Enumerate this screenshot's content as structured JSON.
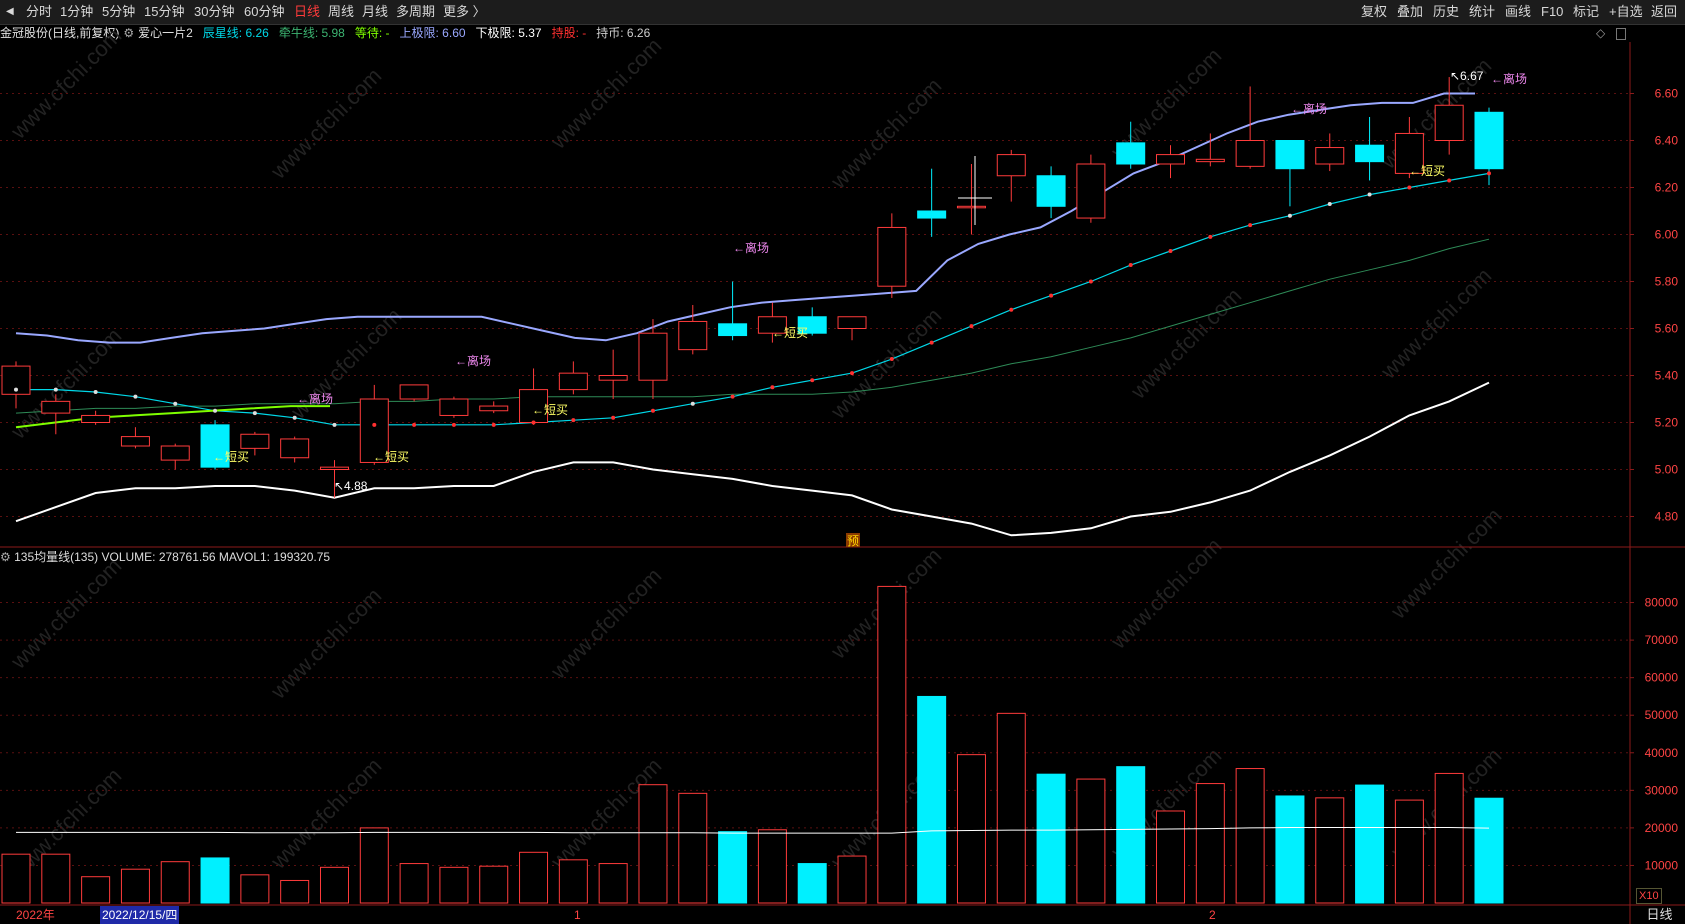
{
  "toolbar": {
    "left_items": [
      "分时",
      "1分钟",
      "5分钟",
      "15分钟",
      "30分钟",
      "60分钟",
      "日线",
      "周线",
      "月线",
      "多周期",
      "更多 〉"
    ],
    "active": "日线",
    "right_items": [
      "复权",
      "叠加",
      "历史",
      "统计",
      "画线",
      "F10",
      "标记",
      "+自选",
      "返回"
    ]
  },
  "title": {
    "stock": "金冠股份(日线,前复权)",
    "indicator": "爱心一片2",
    "items": [
      {
        "label": "辰星线: 6.26",
        "color": "#00d8e8"
      },
      {
        "label": "牵牛线: 5.98",
        "color": "#3cb371"
      },
      {
        "label": "等待: -",
        "color": "#7fff00"
      },
      {
        "label": "上极限: 6.60",
        "color": "#9aa8ff"
      },
      {
        "label": "下极限: 5.37",
        "color": "#ffffff"
      },
      {
        "label": "持股: -",
        "color": "#ff3030"
      },
      {
        "label": "持币: 6.26",
        "color": "#cccccc"
      }
    ]
  },
  "volume_title": "135均量线(135)  VOLUME: 278761.56  MAVOL1: 199320.75",
  "price_axis": [
    "6.60",
    "6.40",
    "6.20",
    "6.00",
    "5.80",
    "5.60",
    "5.40",
    "5.20",
    "5.00",
    "4.80"
  ],
  "volume_axis": [
    "80000",
    "70000",
    "60000",
    "50000",
    "40000",
    "30000",
    "20000",
    "10000"
  ],
  "volume_unit": "X10",
  "right_label": "日线",
  "date_labels": [
    "2022年",
    "2022/12/15/四",
    "1",
    "2"
  ],
  "annotations": {
    "high_label": "6.67",
    "low_label": "4.88",
    "yu": "预",
    "leave": "←离场",
    "buy": "←短买"
  },
  "chart_data": {
    "type": "candlestick",
    "candles": [
      {
        "o": 5.32,
        "c": 5.44,
        "h": 5.46,
        "l": 5.26
      },
      {
        "o": 5.24,
        "c": 5.29,
        "h": 5.32,
        "l": 5.15
      },
      {
        "o": 5.2,
        "c": 5.23,
        "h": 5.25,
        "l": 5.19
      },
      {
        "o": 5.1,
        "c": 5.14,
        "h": 5.18,
        "l": 5.09
      },
      {
        "o": 5.04,
        "c": 5.1,
        "h": 5.11,
        "l": 5.0
      },
      {
        "o": 5.19,
        "c": 5.01,
        "h": 5.21,
        "l": 5.0
      },
      {
        "o": 5.09,
        "c": 5.15,
        "h": 5.16,
        "l": 5.06
      },
      {
        "o": 5.05,
        "c": 5.13,
        "h": 5.14,
        "l": 5.03
      },
      {
        "o": 5.0,
        "c": 5.01,
        "h": 5.04,
        "l": 4.88
      },
      {
        "o": 5.03,
        "c": 5.3,
        "h": 5.36,
        "l": 5.02
      },
      {
        "o": 5.3,
        "c": 5.36,
        "h": 5.36,
        "l": 5.29
      },
      {
        "o": 5.23,
        "c": 5.3,
        "h": 5.31,
        "l": 5.22
      },
      {
        "o": 5.25,
        "c": 5.27,
        "h": 5.29,
        "l": 5.24
      },
      {
        "o": 5.2,
        "c": 5.34,
        "h": 5.43,
        "l": 5.19
      },
      {
        "o": 5.34,
        "c": 5.41,
        "h": 5.46,
        "l": 5.32
      },
      {
        "o": 5.38,
        "c": 5.4,
        "h": 5.51,
        "l": 5.3
      },
      {
        "o": 5.38,
        "c": 5.58,
        "h": 5.64,
        "l": 5.3
      },
      {
        "o": 5.51,
        "c": 5.63,
        "h": 5.7,
        "l": 5.49
      },
      {
        "o": 5.62,
        "c": 5.57,
        "h": 5.8,
        "l": 5.55
      },
      {
        "o": 5.58,
        "c": 5.65,
        "h": 5.71,
        "l": 5.54
      },
      {
        "o": 5.65,
        "c": 5.58,
        "h": 5.69,
        "l": 5.57
      },
      {
        "o": 5.6,
        "c": 5.65,
        "h": 5.65,
        "l": 5.55
      },
      {
        "o": 5.78,
        "c": 6.03,
        "h": 6.09,
        "l": 5.73
      },
      {
        "o": 6.1,
        "c": 6.07,
        "h": 6.28,
        "l": 5.99
      },
      {
        "o": 6.12,
        "c": 6.12,
        "h": 6.3,
        "l": 6.0
      },
      {
        "o": 6.25,
        "c": 6.34,
        "h": 6.36,
        "l": 6.14
      },
      {
        "o": 6.25,
        "c": 6.12,
        "h": 6.29,
        "l": 6.07
      },
      {
        "o": 6.07,
        "c": 6.3,
        "h": 6.34,
        "l": 6.05
      },
      {
        "o": 6.39,
        "c": 6.3,
        "h": 6.48,
        "l": 6.28
      },
      {
        "o": 6.3,
        "c": 6.34,
        "h": 6.38,
        "l": 6.24
      },
      {
        "o": 6.31,
        "c": 6.32,
        "h": 6.43,
        "l": 6.29
      },
      {
        "o": 6.29,
        "c": 6.4,
        "h": 6.63,
        "l": 6.28
      },
      {
        "o": 6.4,
        "c": 6.28,
        "h": 6.4,
        "l": 6.12
      },
      {
        "o": 6.3,
        "c": 6.37,
        "h": 6.43,
        "l": 6.27
      },
      {
        "o": 6.38,
        "c": 6.31,
        "h": 6.5,
        "l": 6.23
      },
      {
        "o": 6.26,
        "c": 6.43,
        "h": 6.5,
        "l": 6.24
      },
      {
        "o": 6.4,
        "c": 6.55,
        "h": 6.67,
        "l": 6.34
      },
      {
        "o": 6.52,
        "c": 6.28,
        "h": 6.54,
        "l": 6.21
      }
    ],
    "upper_band": [
      5.58,
      5.57,
      5.55,
      5.54,
      5.54,
      5.56,
      5.58,
      5.59,
      5.6,
      5.62,
      5.64,
      5.65,
      5.65,
      5.65,
      5.65,
      5.65,
      5.62,
      5.59,
      5.56,
      5.55,
      5.58,
      5.63,
      5.66,
      5.69,
      5.71,
      5.72,
      5.73,
      5.74,
      5.75,
      5.76,
      5.89,
      5.96,
      6.0,
      6.03,
      6.1,
      6.18,
      6.26,
      6.31,
      6.37,
      6.43,
      6.48,
      6.51,
      6.53,
      6.55,
      6.56,
      6.56,
      6.6,
      6.6
    ],
    "lower_band": [
      4.78,
      4.84,
      4.9,
      4.92,
      4.92,
      4.93,
      4.93,
      4.91,
      4.88,
      4.92,
      4.92,
      4.93,
      4.93,
      4.99,
      5.03,
      5.03,
      5.0,
      4.98,
      4.96,
      4.93,
      4.91,
      4.89,
      4.83,
      4.8,
      4.77,
      4.72,
      4.73,
      4.75,
      4.8,
      4.82,
      4.86,
      4.91,
      4.99,
      5.06,
      5.14,
      5.23,
      5.29,
      5.37
    ],
    "star_line": [
      5.34,
      5.34,
      5.33,
      5.31,
      5.28,
      5.25,
      5.24,
      5.22,
      5.19,
      5.19,
      5.19,
      5.19,
      5.19,
      5.2,
      5.21,
      5.22,
      5.25,
      5.28,
      5.31,
      5.35,
      5.38,
      5.41,
      5.47,
      5.54,
      5.61,
      5.68,
      5.74,
      5.8,
      5.87,
      5.93,
      5.99,
      6.04,
      6.08,
      6.13,
      6.17,
      6.2,
      6.23,
      6.26
    ],
    "ox_line": [
      5.24,
      5.25,
      5.26,
      5.26,
      5.27,
      5.27,
      5.28,
      5.28,
      5.28,
      5.29,
      5.29,
      5.3,
      5.3,
      5.31,
      5.31,
      5.31,
      5.31,
      5.31,
      5.32,
      5.32,
      5.32,
      5.33,
      5.35,
      5.38,
      5.41,
      5.45,
      5.48,
      5.52,
      5.56,
      5.61,
      5.66,
      5.71,
      5.76,
      5.81,
      5.85,
      5.89,
      5.94,
      5.98
    ],
    "wait_line": [
      5.18,
      5.2,
      5.22,
      5.23,
      5.24,
      5.25,
      5.26,
      5.27,
      5.27
    ],
    "volume": [
      13000,
      13000,
      7000,
      9000,
      11000,
      12000,
      7500,
      6000,
      9500,
      20000,
      10500,
      9500,
      9800,
      13500,
      11500,
      10500,
      31500,
      29200,
      19000,
      19500,
      10500,
      12500,
      84300,
      55000,
      39500,
      50500,
      34300,
      33000,
      36300,
      24500,
      31800,
      35800,
      28500,
      28000,
      31400,
      27400,
      34500,
      27900
    ],
    "mavol": [
      18800,
      18800,
      18800,
      18800,
      18800,
      18800,
      18700,
      18700,
      18700,
      18800,
      18800,
      18800,
      18800,
      18800,
      18700,
      18700,
      18700,
      18700,
      18600,
      18600,
      18600,
      18600,
      18600,
      19200,
      19300,
      19400,
      19400,
      19500,
      19600,
      19700,
      19800,
      20000,
      20100,
      20100,
      20100,
      20100,
      20100,
      19932
    ],
    "price_ylim": [
      4.7,
      6.7
    ],
    "volume_ylim": [
      0,
      90000
    ]
  }
}
